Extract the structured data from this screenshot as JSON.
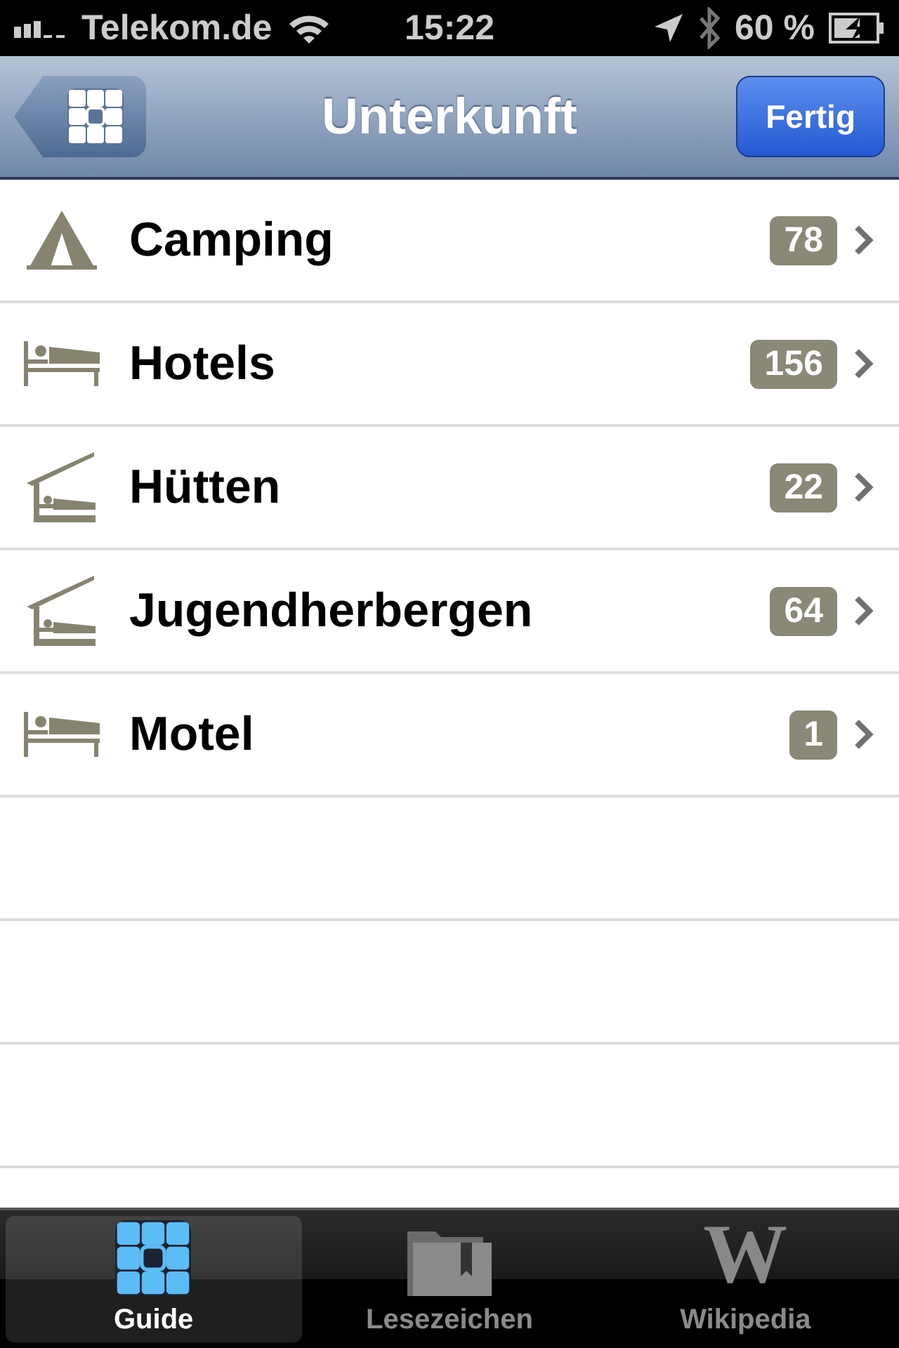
{
  "status_bar": {
    "carrier": "Telekom.de",
    "time": "15:22",
    "battery": "60 %"
  },
  "nav_bar": {
    "title": "Unterkunft",
    "done_button": "Fertig"
  },
  "rows": [
    {
      "kind": "tent",
      "label": "Camping",
      "count": "78"
    },
    {
      "kind": "bed",
      "label": "Hotels",
      "count": "156"
    },
    {
      "kind": "hut",
      "label": "Hütten",
      "count": "22"
    },
    {
      "kind": "hut",
      "label": "Jugendherbergen",
      "count": "64"
    },
    {
      "kind": "bed",
      "label": "Motel",
      "count": "1"
    }
  ],
  "tab_bar": [
    {
      "kind": "grid",
      "label": "Guide",
      "selected": true
    },
    {
      "kind": "folder",
      "label": "Lesezeichen",
      "selected": false
    },
    {
      "kind": "glyph",
      "glyph": "W",
      "label": "Wikipedia",
      "selected": false
    }
  ]
}
